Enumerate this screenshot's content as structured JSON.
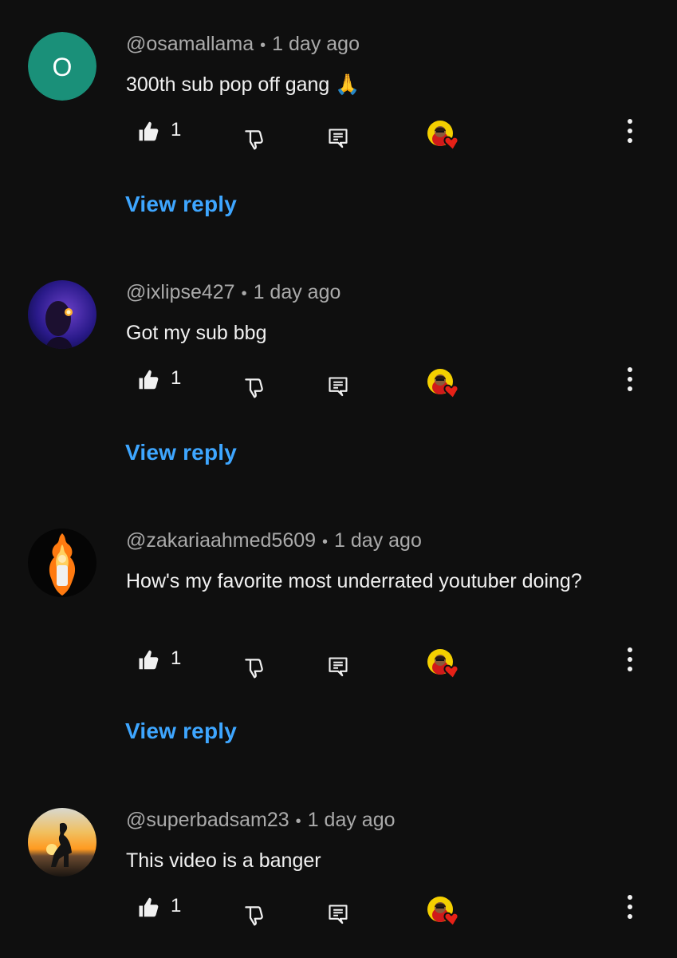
{
  "comments": [
    {
      "username": "@osamallama",
      "time": "1 day ago",
      "text": "300th sub pop off gang 🙏",
      "likes": "1",
      "avatar_letter": "O",
      "avatar_color": "#1a9079",
      "view_reply": "View reply"
    },
    {
      "username": "@ixlipse427",
      "time": "1 day ago",
      "text": "Got my sub bbg",
      "likes": "1",
      "view_reply": "View reply"
    },
    {
      "username": "@zakariaahmed5609",
      "time": "1 day ago",
      "text": "How's my favorite most underrated youtuber doing?",
      "likes": "1",
      "view_reply": "View reply"
    },
    {
      "username": "@superbadsam23",
      "time": "1 day ago",
      "text": "This video is a banger",
      "likes": "1"
    }
  ],
  "colors": {
    "background": "#0f0f0f",
    "link": "#3ea6ff",
    "meta": "#aaaaaa",
    "heart": "#e62117"
  }
}
